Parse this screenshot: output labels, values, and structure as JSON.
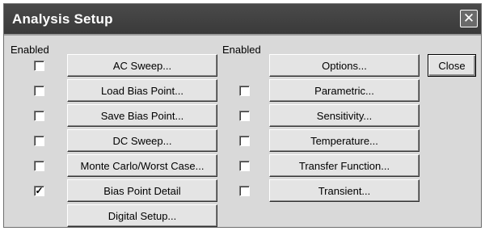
{
  "window": {
    "title": "Analysis Setup",
    "close_glyph": "✕"
  },
  "left_column": {
    "header": "Enabled",
    "rows": [
      {
        "label": "AC Sweep...",
        "checked": false
      },
      {
        "label": "Load Bias Point...",
        "checked": false
      },
      {
        "label": "Save Bias Point...",
        "checked": false
      },
      {
        "label": "DC Sweep...",
        "checked": false
      },
      {
        "label": "Monte Carlo/Worst Case...",
        "checked": false
      },
      {
        "label": "Bias Point Detail",
        "checked": true
      },
      {
        "label": "Digital Setup...",
        "checked": null
      }
    ]
  },
  "right_column": {
    "header": "Enabled",
    "rows": [
      {
        "label": "Options...",
        "checked": null
      },
      {
        "label": "Parametric...",
        "checked": false
      },
      {
        "label": "Sensitivity...",
        "checked": false
      },
      {
        "label": "Temperature...",
        "checked": false
      },
      {
        "label": "Transfer Function...",
        "checked": false
      },
      {
        "label": "Transient...",
        "checked": false
      }
    ]
  },
  "close_button_label": "Close",
  "check_glyph": "✓"
}
